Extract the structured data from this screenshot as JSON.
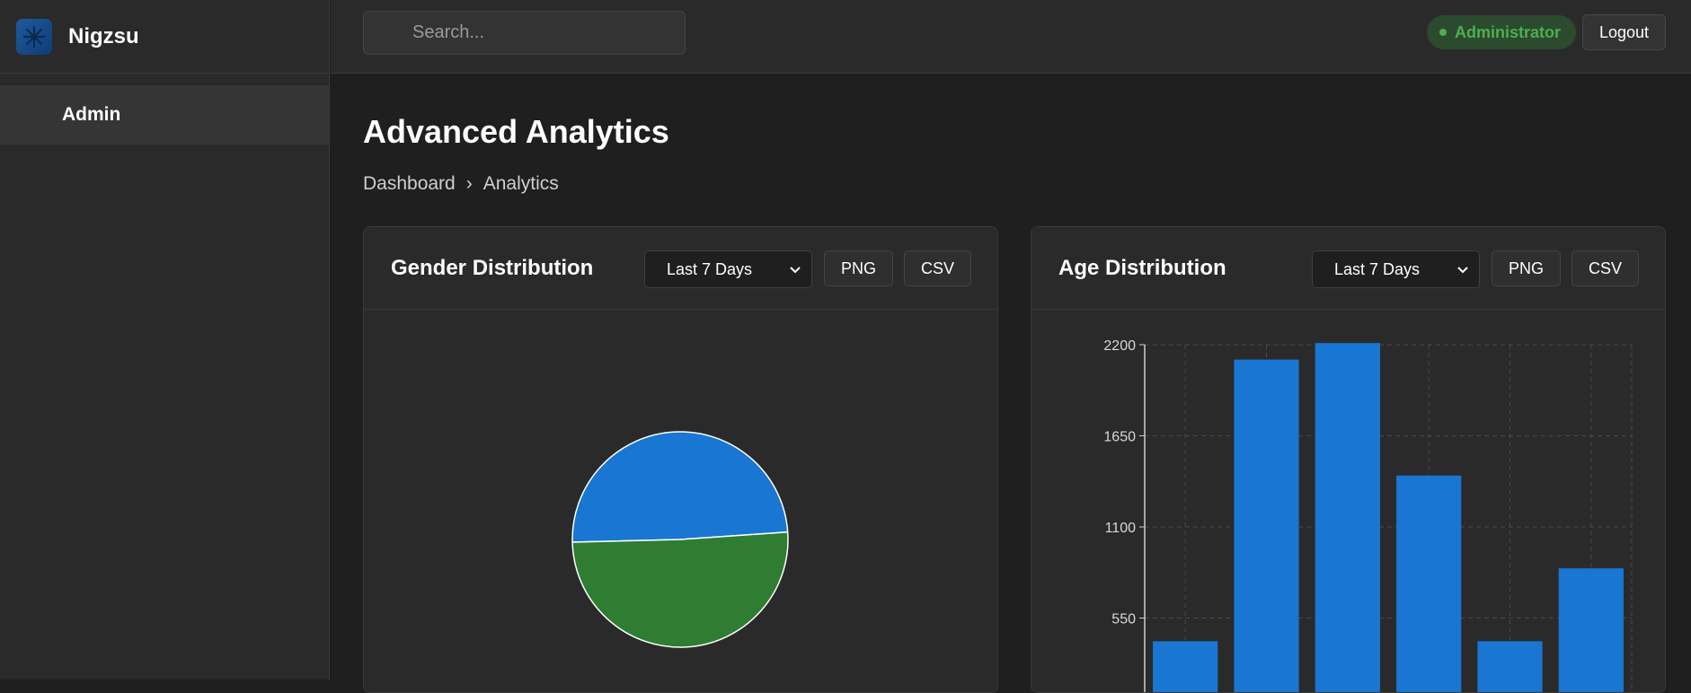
{
  "app": {
    "name": "Nigzsu"
  },
  "sidebar": {
    "items": [
      {
        "label": "Admin"
      }
    ]
  },
  "topbar": {
    "search_placeholder": "Search...",
    "role": "Administrator",
    "logout_label": "Logout"
  },
  "page": {
    "title": "Advanced Analytics",
    "breadcrumb": [
      "Dashboard",
      "›",
      "Analytics"
    ]
  },
  "cards": [
    {
      "title": "Gender Distribution",
      "range": "Last 7 Days",
      "png_label": "PNG",
      "csv_label": "CSV",
      "chart_data": {
        "type": "pie",
        "slices": [
          {
            "value": 49.3,
            "color": "#1976d2"
          },
          {
            "value": 50.7,
            "color": "#2e7d32"
          }
        ]
      }
    },
    {
      "title": "Age Distribution",
      "range": "Last 7 Days",
      "png_label": "PNG",
      "csv_label": "CSV",
      "chart_data": {
        "type": "bar",
        "values": [
          410,
          2110,
          2210,
          1410,
          410,
          850
        ],
        "ylim": [
          0,
          2200
        ],
        "yticks": [
          550,
          1100,
          1650,
          2200
        ],
        "color": "#1976d2",
        "grid": true
      }
    }
  ]
}
